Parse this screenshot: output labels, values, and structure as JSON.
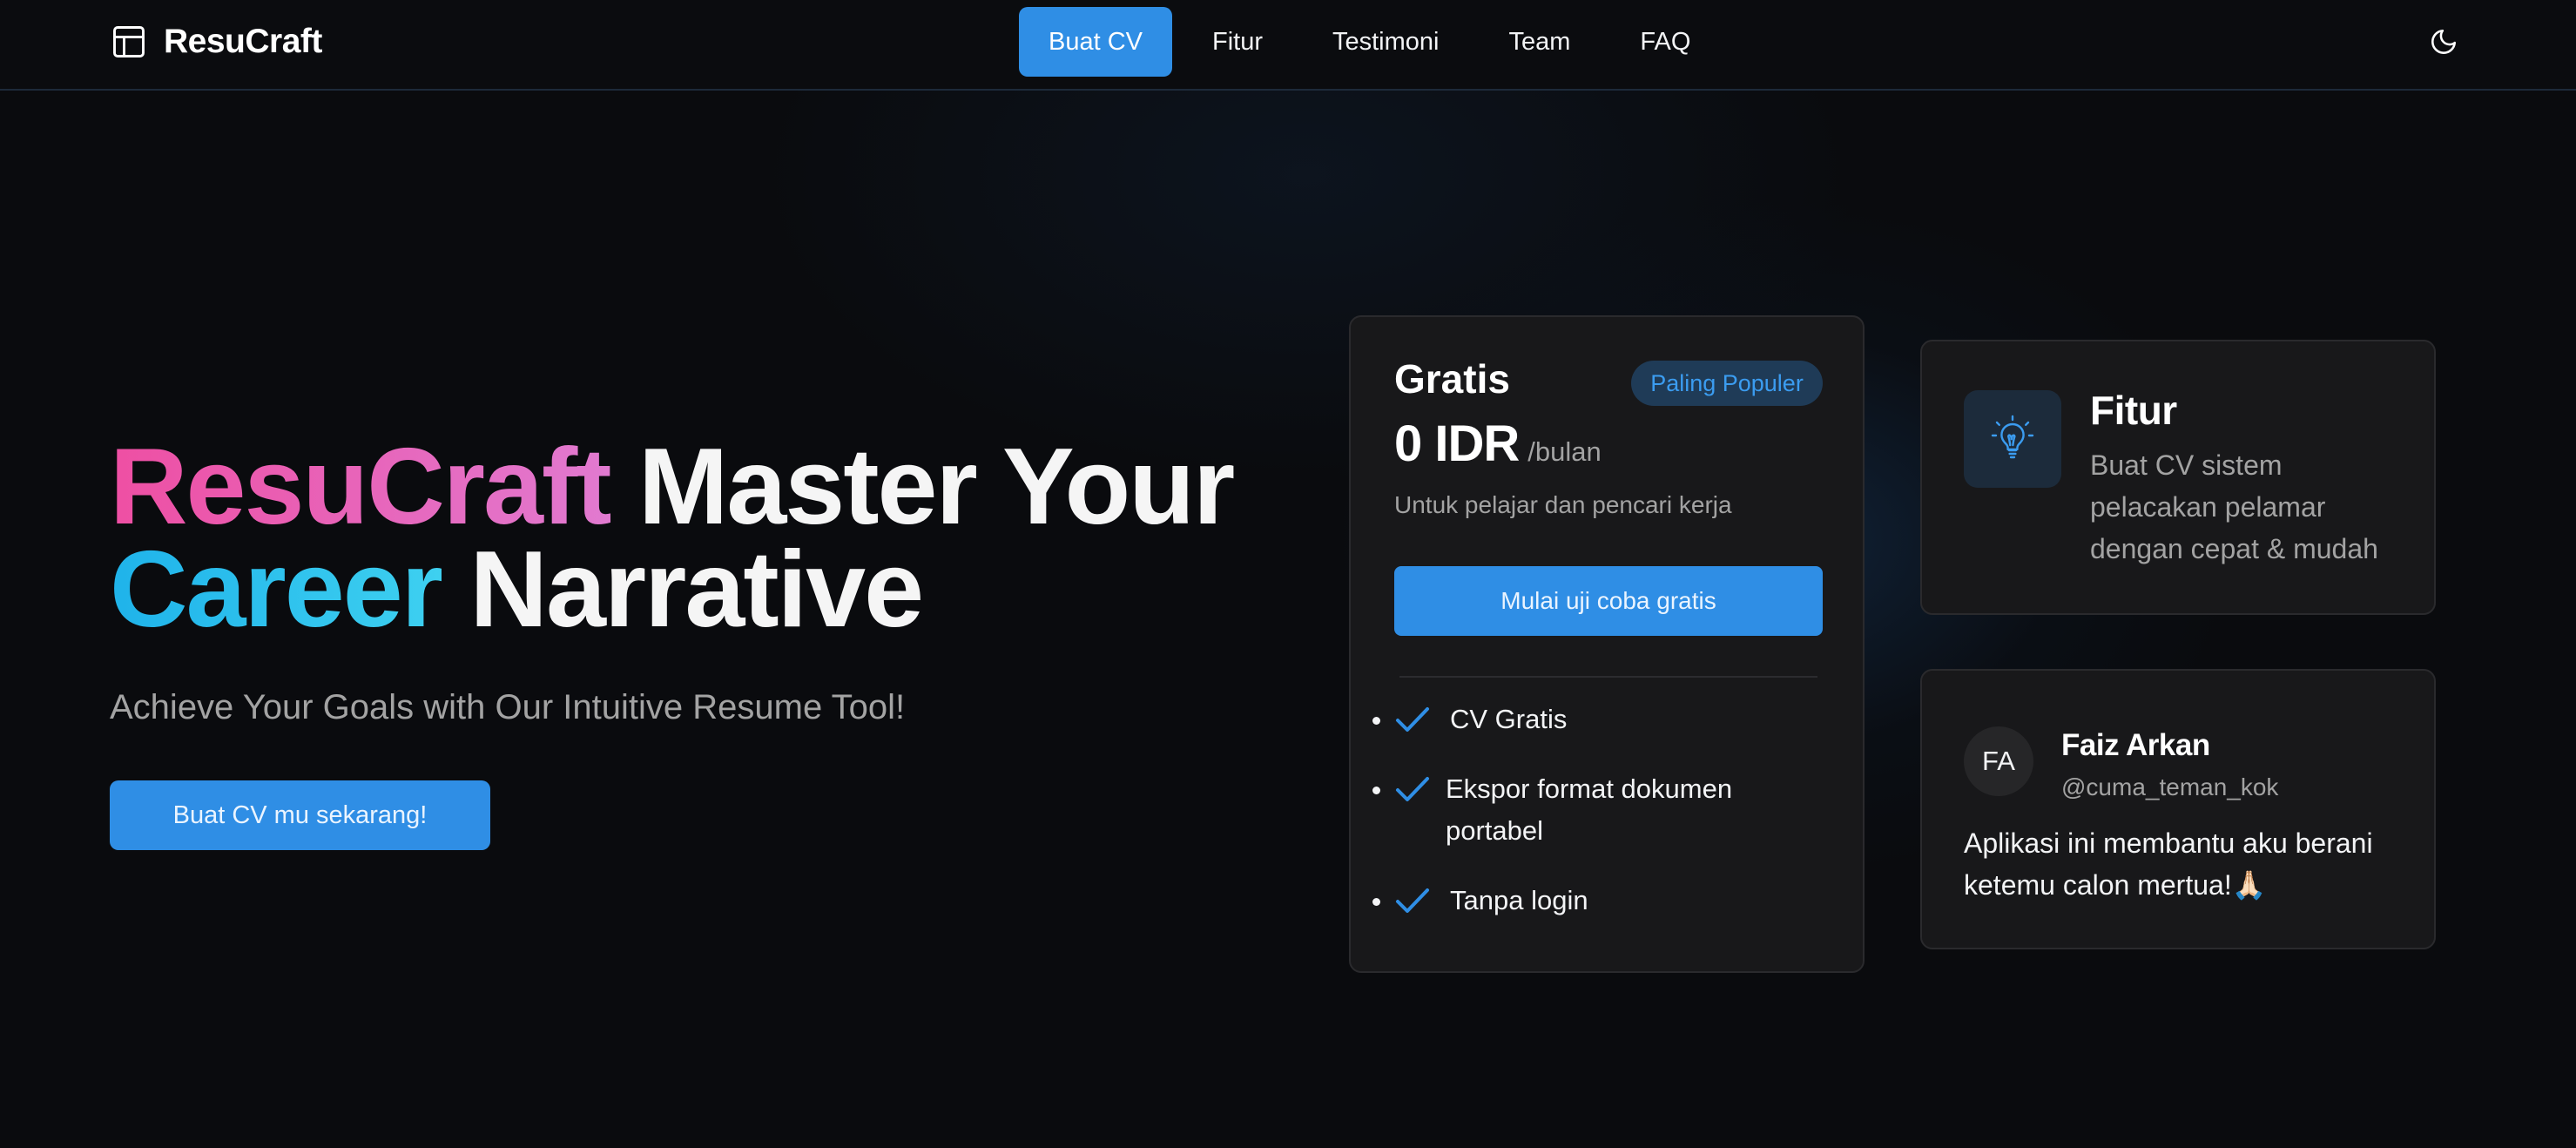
{
  "brand": {
    "name": "ResuCraft",
    "icon": "layout-icon"
  },
  "nav": {
    "items": [
      {
        "label": "Buat CV",
        "active": true
      },
      {
        "label": "Fitur",
        "active": false
      },
      {
        "label": "Testimoni",
        "active": false
      },
      {
        "label": "Team",
        "active": false
      },
      {
        "label": "FAQ",
        "active": false
      }
    ],
    "theme_toggle_icon": "moon-icon"
  },
  "hero": {
    "title_part1": "ResuCraft",
    "title_part2": " Master Your",
    "title_part3": "Career",
    "title_part4": " Narrative",
    "subtitle": "Achieve Your Goals with Our Intuitive Resume Tool!",
    "cta_label": "Buat CV mu sekarang!"
  },
  "pricing": {
    "plan_name": "Gratis",
    "badge": "Paling Populer",
    "price": "0 IDR",
    "period": "/bulan",
    "description": "Untuk pelajar dan pencari kerja",
    "cta_label": "Mulai uji coba gratis",
    "features": [
      {
        "label": "CV Gratis"
      },
      {
        "label": "Ekspor format dokumen portabel"
      },
      {
        "label": "Tanpa login"
      }
    ],
    "check_icon": "check-icon"
  },
  "feature_card": {
    "icon": "lightbulb-icon",
    "title": "Fitur",
    "description": "Buat CV sistem pelacakan pelamar dengan cepat & mudah"
  },
  "testimonial": {
    "initials": "FA",
    "name": "Faiz Arkan",
    "handle": "@cuma_teman_kok",
    "text": "Aplikasi ini membantu aku berani ketemu calon mertua!🙏🏻"
  },
  "colors": {
    "accent": "#2f8ee5",
    "background": "#0a0b0e",
    "card": "#18181a",
    "pink_gradient": "#ee4fa3",
    "cyan_gradient": "#1fb3ea"
  }
}
